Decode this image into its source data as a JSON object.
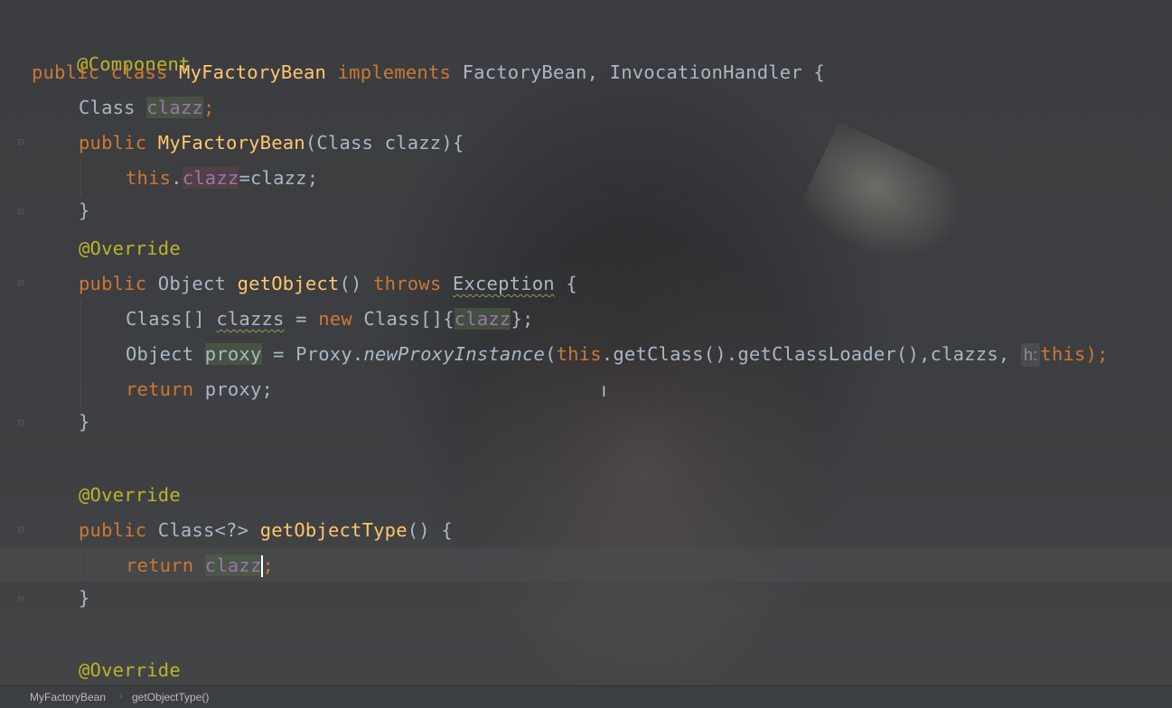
{
  "code": {
    "l1": {
      "ann": "@Component"
    },
    "l2": {
      "kw1": "public class ",
      "name": "MyFactoryBean ",
      "kw2": "implements ",
      "rest": "FactoryBean, InvocationHandler {"
    },
    "l3": {
      "type": "Class ",
      "field": "clazz",
      "semi": ";"
    },
    "l4": {
      "kw": "public ",
      "ctor": "MyFactoryBean",
      "params": "(Class clazz){"
    },
    "l5": {
      "kw": "this",
      "dot": ".",
      "field": "clazz",
      "rest": "=clazz;"
    },
    "l6": {
      "brace": "}"
    },
    "l7": {
      "ann": "@Override"
    },
    "l8": {
      "kw": "public ",
      "type": "Object ",
      "fn": "getObject",
      "paren": "() ",
      "kw2": "throws ",
      "exc": "Exception",
      "rest": " {"
    },
    "l9": {
      "pre": "Class[] ",
      "var": "clazzs",
      "mid": " = ",
      "kw": "new ",
      "rest1": "Class[]{",
      "arg": "clazz",
      "rest2": "};"
    },
    "l10": {
      "pre": "Object ",
      "var": "proxy",
      "mid": " = Proxy.",
      "fn": "newProxyInstance",
      "open": "(",
      "kw": "this",
      "rest": ".getClass().getClassLoader(),clazzs, ",
      "hint": "h:",
      "kw2": "this",
      "close": ");"
    },
    "l11": {
      "kw": "return ",
      "rest": "proxy;"
    },
    "l12": {
      "brace": "}"
    },
    "l13": {
      "ann": "@Override"
    },
    "l14": {
      "kw": "public ",
      "type": "Class<?> ",
      "fn": "getObjectType",
      "rest": "() {"
    },
    "l15": {
      "kw": "return ",
      "field": "clazz",
      "semi": ";"
    },
    "l16": {
      "brace": "}"
    },
    "l17": {
      "ann": "@Override"
    }
  },
  "breadcrumb": {
    "items": [
      "MyFactoryBean",
      "getObjectType()"
    ],
    "separator": "›"
  },
  "mouse_cursor_glyph": "I",
  "colors": {
    "keyword": "#cc7832",
    "annotation": "#bbb529",
    "method": "#ffc66d",
    "field": "#9876aa",
    "text": "#a9b7c6"
  }
}
